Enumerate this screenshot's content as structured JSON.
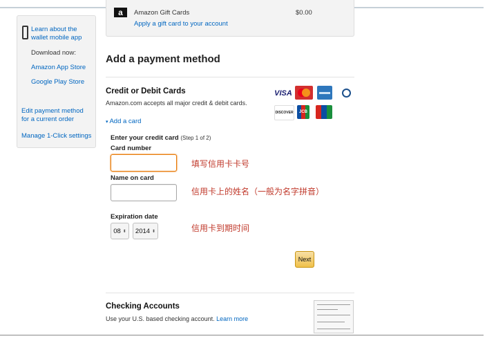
{
  "sidebar": {
    "wallet_link": "Learn about the wallet mobile app",
    "download_label": "Download now:",
    "app_store_link": "Amazon App Store",
    "play_store_link": "Google Play Store",
    "edit_payment_link": "Edit payment method for a current order",
    "one_click_link": "Manage 1-Click settings"
  },
  "gift_card": {
    "title": "Amazon Gift Cards",
    "amount": "$0.00",
    "apply_link": "Apply a gift card to your account",
    "logo_letter": "a"
  },
  "main": {
    "heading": "Add a payment method",
    "credit": {
      "title": "Credit or Debit Cards",
      "subtitle": "Amazon.com accepts all major credit & debit cards.",
      "add_card_link": "Add a card",
      "logos": [
        "VISA",
        "MasterCard",
        "AMEX",
        "Diners Club",
        "DISCOVER",
        "JCB",
        "UnionPay"
      ]
    },
    "form": {
      "step_title": "Enter your credit card",
      "step_note": "(Step 1 of 2)",
      "card_number_label": "Card number",
      "card_number_note": "填写信用卡卡号",
      "name_label": "Name on card",
      "name_note": "信用卡上的姓名（一般为名字拼音）",
      "expiration_label": "Expiration date",
      "month": "08",
      "year": "2014",
      "expiration_note": "信用卡到期时间",
      "next_button": "Next"
    },
    "checking": {
      "title": "Checking Accounts",
      "subtitle": "Use your U.S. based checking account.",
      "learn_more": "Learn more"
    }
  }
}
